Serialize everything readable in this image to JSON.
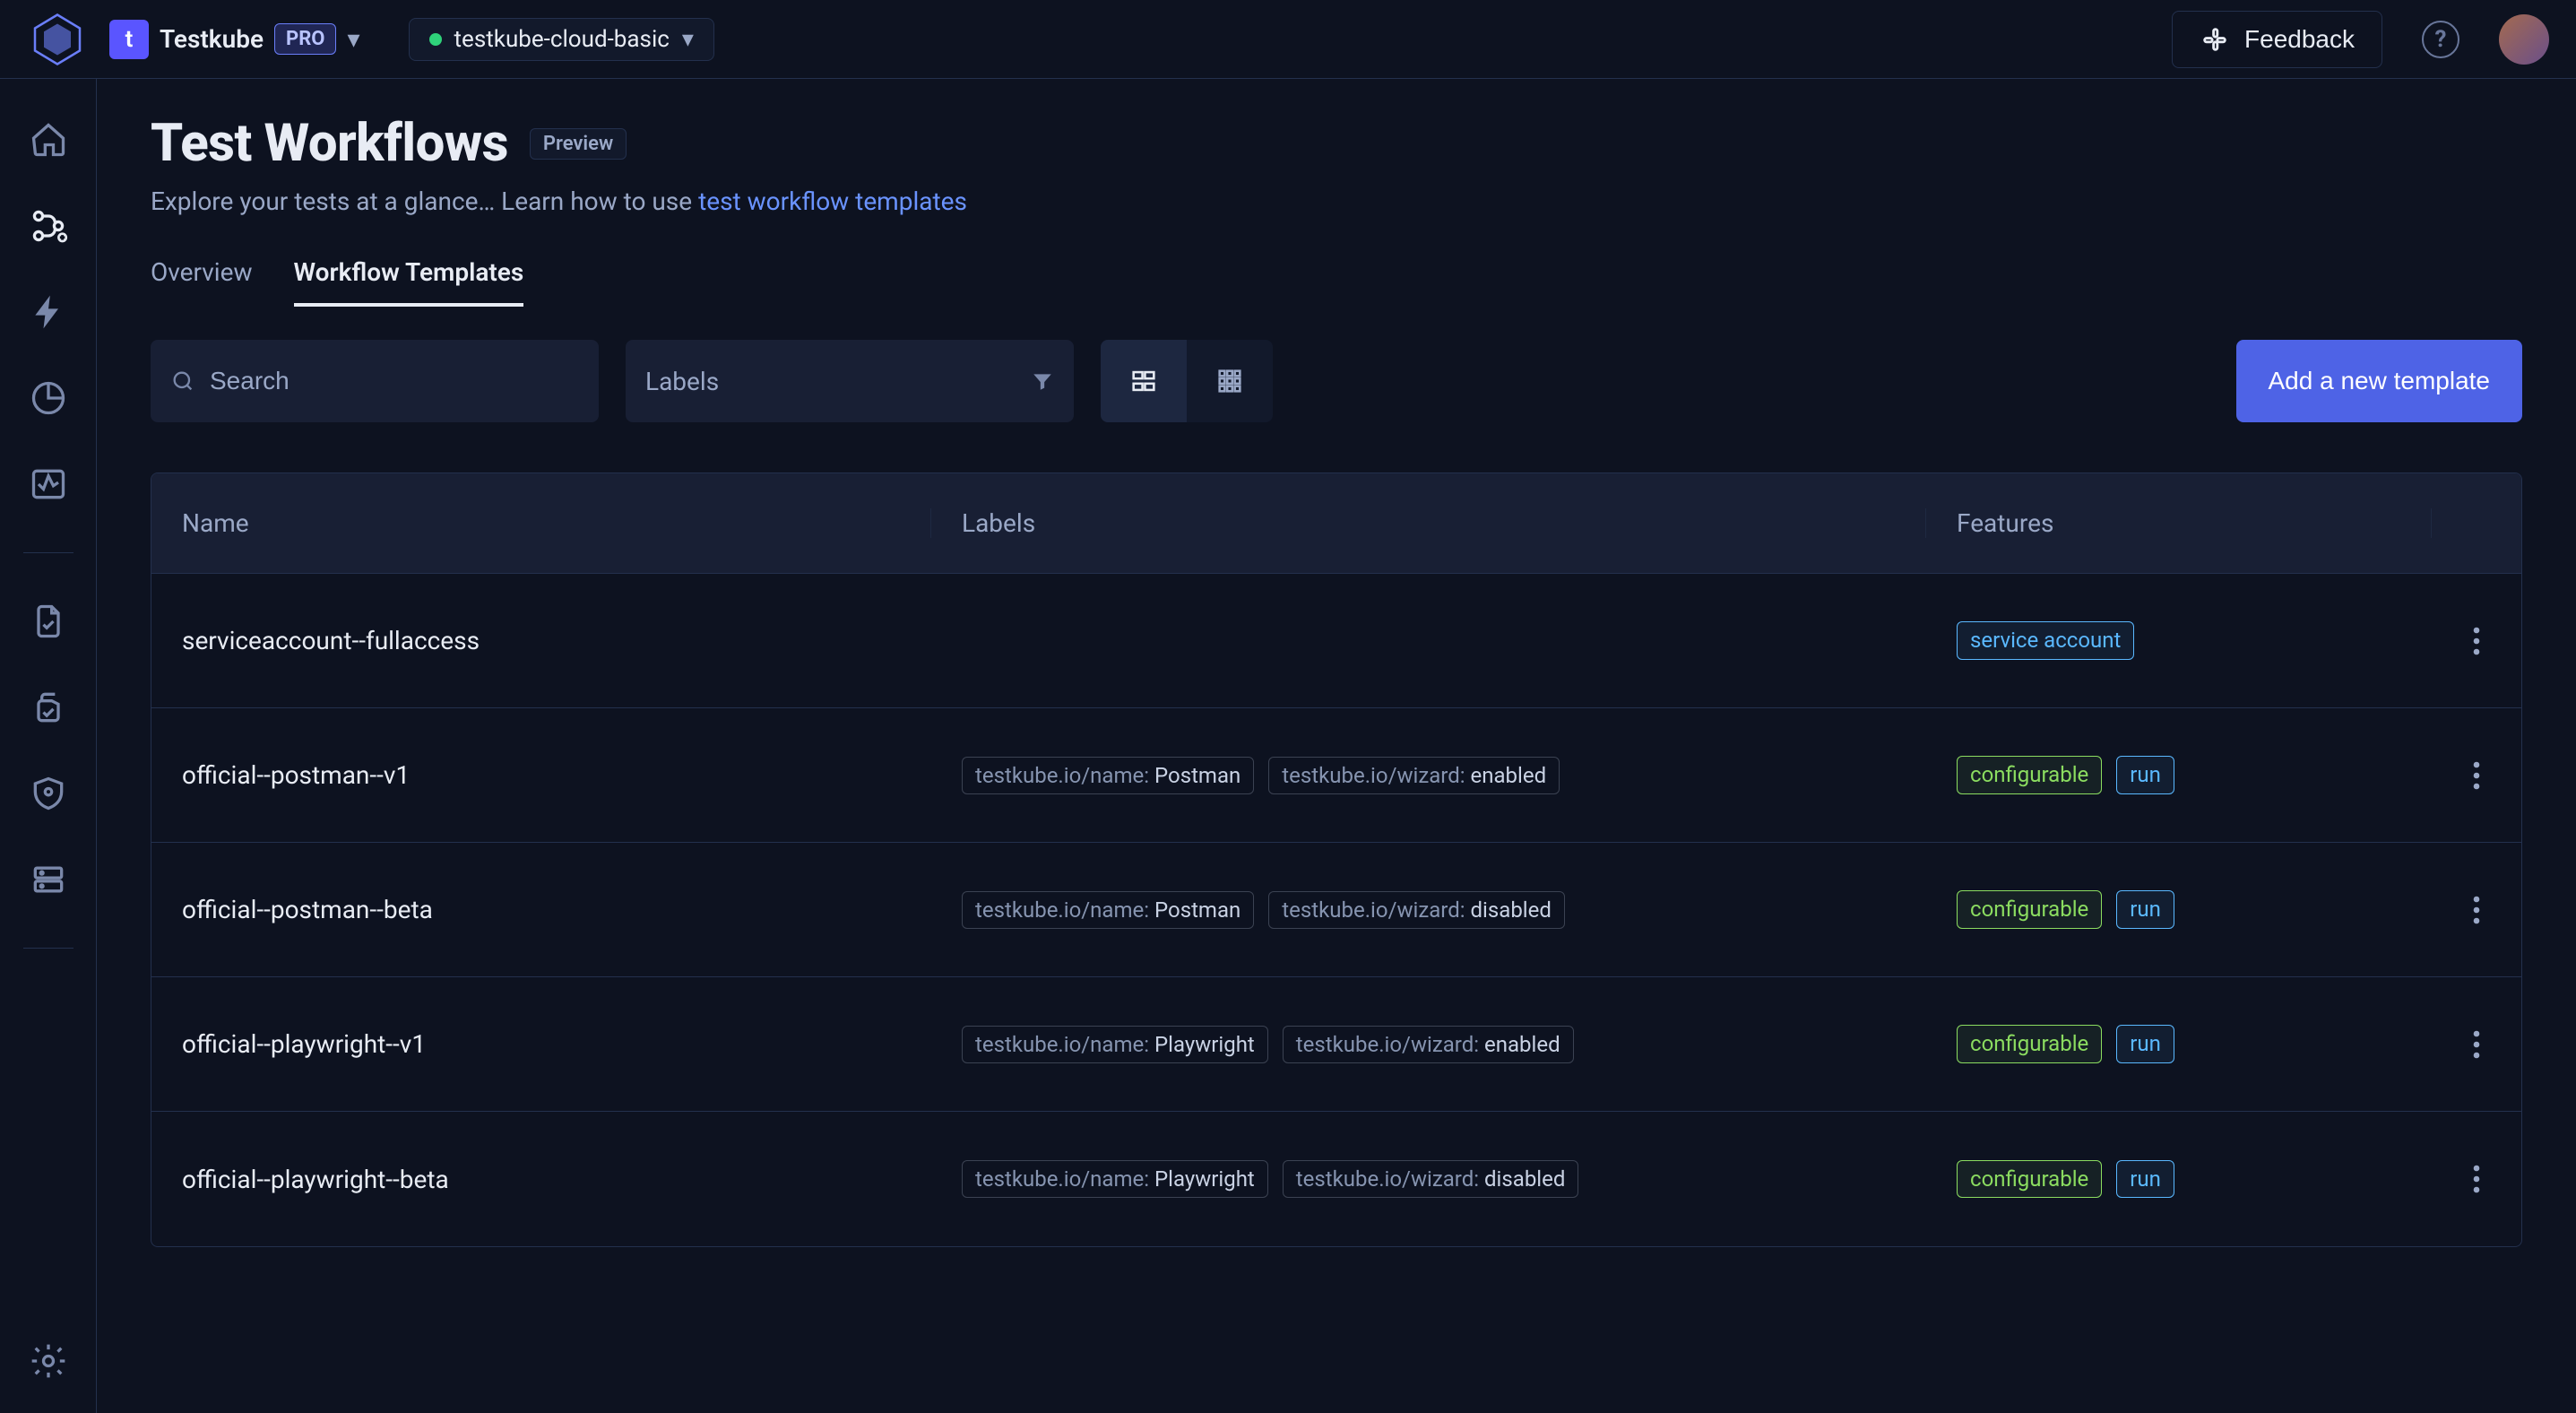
{
  "header": {
    "org_initial": "t",
    "org_name": "Testkube",
    "pro_badge": "PRO",
    "environment": "testkube-cloud-basic",
    "feedback_label": "Feedback"
  },
  "page": {
    "title": "Test Workflows",
    "preview_badge": "Preview",
    "description_prefix": "Explore your tests at a glance… Learn how to use ",
    "description_link": "test workflow templates"
  },
  "tabs": {
    "overview": "Overview",
    "workflow_templates": "Workflow Templates"
  },
  "controls": {
    "search_placeholder": "Search",
    "labels_placeholder": "Labels",
    "add_button": "Add a new template"
  },
  "table": {
    "columns": {
      "name": "Name",
      "labels": "Labels",
      "features": "Features"
    },
    "rows": [
      {
        "name": "serviceaccount--fullaccess",
        "labels": [],
        "features": [
          {
            "text": "service account",
            "variant": "blue"
          }
        ]
      },
      {
        "name": "official--postman--v1",
        "labels": [
          {
            "key": "testkube.io/name:",
            "value": " Postman"
          },
          {
            "key": "testkube.io/wizard:",
            "value": " enabled"
          }
        ],
        "features": [
          {
            "text": "configurable",
            "variant": "green"
          },
          {
            "text": "run",
            "variant": "blue"
          }
        ]
      },
      {
        "name": "official--postman--beta",
        "labels": [
          {
            "key": "testkube.io/name:",
            "value": " Postman"
          },
          {
            "key": "testkube.io/wizard:",
            "value": " disabled"
          }
        ],
        "features": [
          {
            "text": "configurable",
            "variant": "green"
          },
          {
            "text": "run",
            "variant": "blue"
          }
        ]
      },
      {
        "name": "official--playwright--v1",
        "labels": [
          {
            "key": "testkube.io/name:",
            "value": " Playwright"
          },
          {
            "key": "testkube.io/wizard:",
            "value": " enabled"
          }
        ],
        "features": [
          {
            "text": "configurable",
            "variant": "green"
          },
          {
            "text": "run",
            "variant": "blue"
          }
        ]
      },
      {
        "name": "official--playwright--beta",
        "labels": [
          {
            "key": "testkube.io/name:",
            "value": " Playwright"
          },
          {
            "key": "testkube.io/wizard:",
            "value": " disabled"
          }
        ],
        "features": [
          {
            "text": "configurable",
            "variant": "green"
          },
          {
            "text": "run",
            "variant": "blue"
          }
        ]
      }
    ]
  }
}
